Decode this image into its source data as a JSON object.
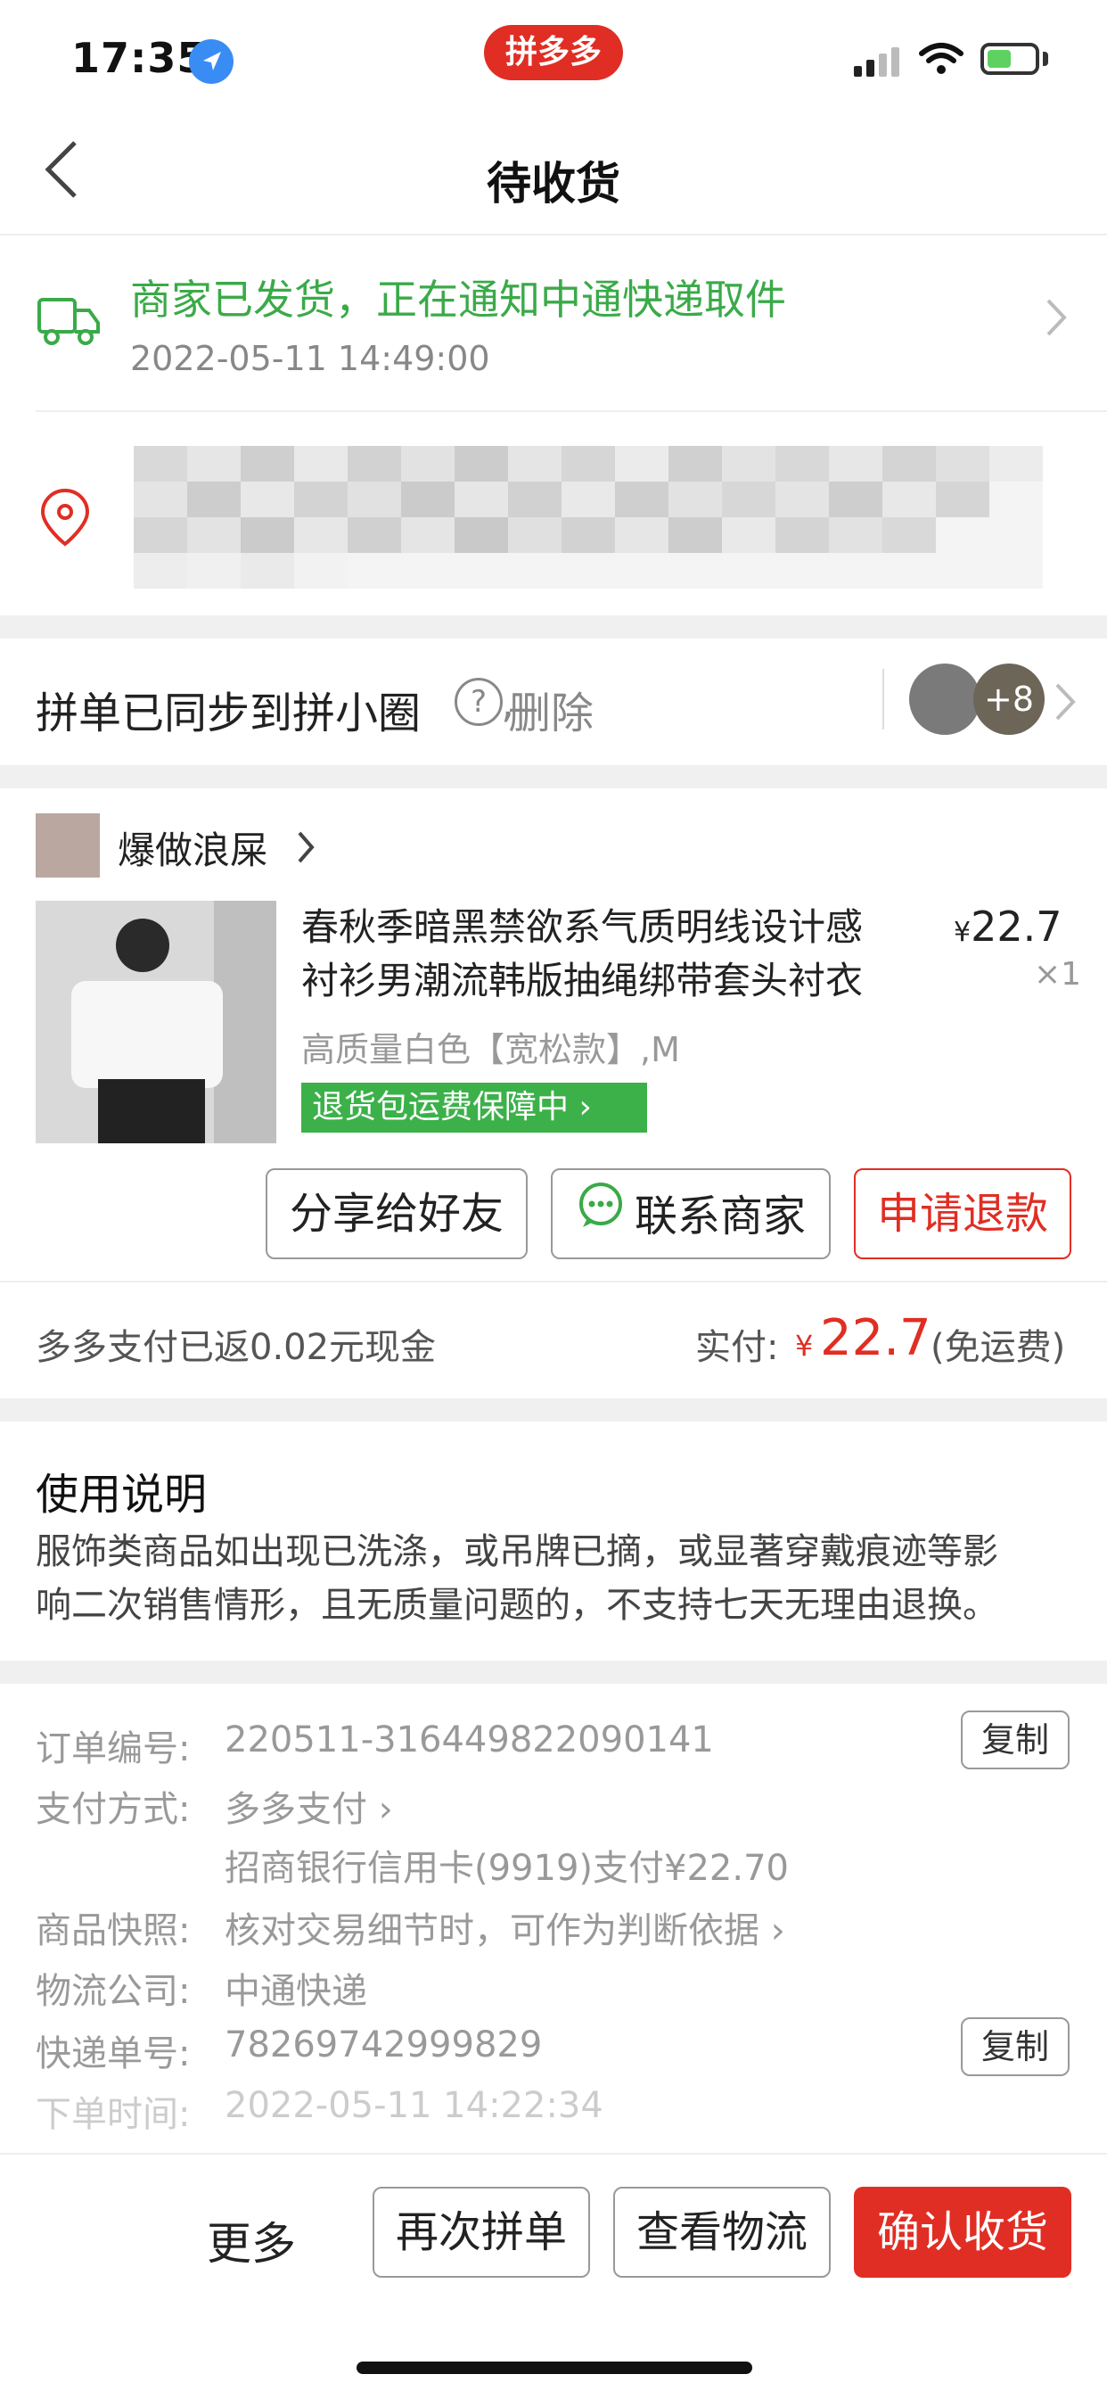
{
  "status_bar": {
    "time": "17:35",
    "app_badge": "拼多多"
  },
  "nav": {
    "title": "待收货"
  },
  "shipping": {
    "status_text": "商家已发货，正在通知中通快递取件",
    "time": "2022-05-11 14:49:00"
  },
  "group": {
    "text": "拼单已同步到拼小圈",
    "delete": "删除",
    "avatar_count": "+8"
  },
  "shop": {
    "name": "爆做浪屎"
  },
  "product": {
    "title_line1": "春秋季暗黑禁欲系气质明线设计感",
    "title_line2": "衬衫男潮流韩版抽绳绑带套头衬衣",
    "price_symbol": "¥",
    "price": "22.7",
    "qty": "×1",
    "spec": "高质量白色【宽松款】,M",
    "guarantee": "退货包运费保障中"
  },
  "actions": {
    "share": "分享给好友",
    "contact": "联系商家",
    "refund": "申请退款"
  },
  "payment_summary": {
    "cashback": "多多支付已返0.02元现金",
    "paid_label": "实付:",
    "paid_symbol": "¥",
    "paid_value": "22.7",
    "paid_note": "(免运费)"
  },
  "usage": {
    "heading": "使用说明",
    "line1": "服饰类商品如出现已洗涤，或吊牌已摘，或显著穿戴痕迹等影",
    "line2": "响二次销售情形，且无质量问题的，不支持七天无理由退换。"
  },
  "order_info": {
    "order_no_label": "订单编号:",
    "order_no": "220511-316449822090141",
    "pay_method_label": "支付方式:",
    "pay_method": "多多支付",
    "pay_detail": "招商银行信用卡(9919)支付¥22.70",
    "snapshot_label": "商品快照:",
    "snapshot": "核对交易细节时，可作为判断依据",
    "logistics_label": "物流公司:",
    "logistics": "中通快递",
    "tracking_label": "快递单号:",
    "tracking_no": "78269742999829",
    "order_time_label": "下单时间:",
    "order_time": "2022-05-11 14:22:34",
    "copy": "复制"
  },
  "bottom_bar": {
    "more": "更多",
    "regroup": "再次拼单",
    "view_logistics": "查看物流",
    "confirm": "确认收货"
  }
}
